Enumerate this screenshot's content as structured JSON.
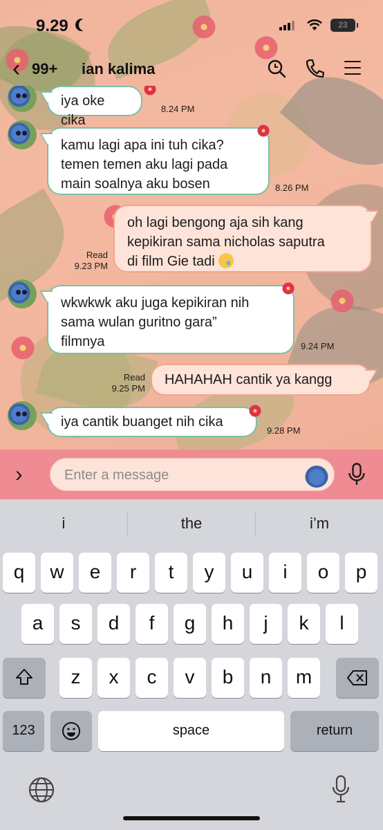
{
  "status_bar": {
    "time": "9.29",
    "battery": "23"
  },
  "header": {
    "back_badge": "99+",
    "contact_name": "ian kalima"
  },
  "messages": [
    {
      "text": "iya oke cika",
      "time": "8.24 PM"
    },
    {
      "lines": [
        "kamu lagi apa ini tuh cika?",
        "temen temen aku lagi pada",
        "main soalnya aku bosen"
      ],
      "time": "8.26 PM"
    },
    {
      "lines": [
        "oh lagi bengong aja sih kang",
        "kepikiran sama nicholas saputra",
        "di film Gie tadi"
      ],
      "read": "Read",
      "time": "9.23 PM"
    },
    {
      "lines": [
        "wkwkwk aku juga kepikiran nih",
        "sama wulan guritno gara”",
        "filmnya"
      ],
      "time": "9.24 PM"
    },
    {
      "text": "HAHAHAH cantik ya kangg",
      "read": "Read",
      "time": "9.25 PM"
    },
    {
      "text": "iya cantik buanget nih cika",
      "time": "9.28 PM"
    }
  ],
  "input": {
    "placeholder": "Enter a message"
  },
  "keyboard": {
    "suggestions": [
      "i",
      "the",
      "i’m"
    ],
    "row1": [
      "q",
      "w",
      "e",
      "r",
      "t",
      "y",
      "u",
      "i",
      "o",
      "p"
    ],
    "row2": [
      "a",
      "s",
      "d",
      "f",
      "g",
      "h",
      "j",
      "k",
      "l"
    ],
    "row3": [
      "z",
      "x",
      "c",
      "v",
      "b",
      "n",
      "m"
    ],
    "numbers": "123",
    "space": "space",
    "return": "return"
  }
}
